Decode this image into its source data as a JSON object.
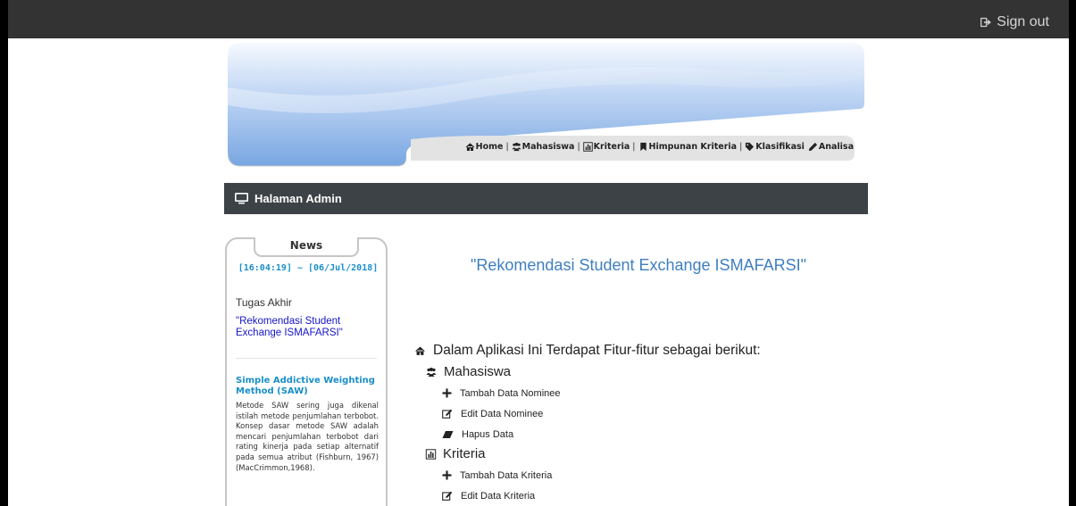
{
  "topbar": {
    "signout_label": "Sign out"
  },
  "nav": {
    "home": "Home",
    "mahasiswa": "Mahasiswa",
    "kriteria": "Kriteria",
    "himpunan": "Himpunan Kriteria",
    "klasifikasi": "Klasifikasi",
    "analisa": "Analisa",
    "separator": "|"
  },
  "admin_bar": {
    "title": "Halaman Admin"
  },
  "news": {
    "title": "News",
    "datetime": "[16:04:19] ~ [06/Jul/2018]",
    "tugas_akhir": "Tugas Akhir",
    "rekomendasi": "\"Rekomendasi Student Exchange ISMAFARSI\"",
    "saw_title": "Simple Addictive Weighting Method (SAW)",
    "saw_body": "Metode SAW sering juga dikenal istilah metode penjumlahan terbobot. Konsep dasar metode SAW adalah mencari penjumlahan terbobot dari rating kinerja pada setiap alternatif pada semua atribut (Fishburn, 1967) (MacCrimmon,1968)."
  },
  "main": {
    "title": "\"Rekomendasi Student Exchange ISMAFARSI\"",
    "features_heading": "Dalam Aplikasi Ini Terdapat Fitur-fitur sebagai berikut:",
    "sections": [
      {
        "label": "Mahasiswa",
        "items": [
          "Tambah Data Nominee",
          "Edit Data Nominee",
          "Hapus Data"
        ]
      },
      {
        "label": "Kriteria",
        "items": [
          "Tambah Data Kriteria",
          "Edit Data Kriteria"
        ]
      }
    ]
  },
  "colors": {
    "topbar": "#333333",
    "admin_bar": "#3d4246",
    "accent_blue": "#3f7fbf",
    "news_blue": "#1a8fc9",
    "link_blue": "#1515c8"
  }
}
